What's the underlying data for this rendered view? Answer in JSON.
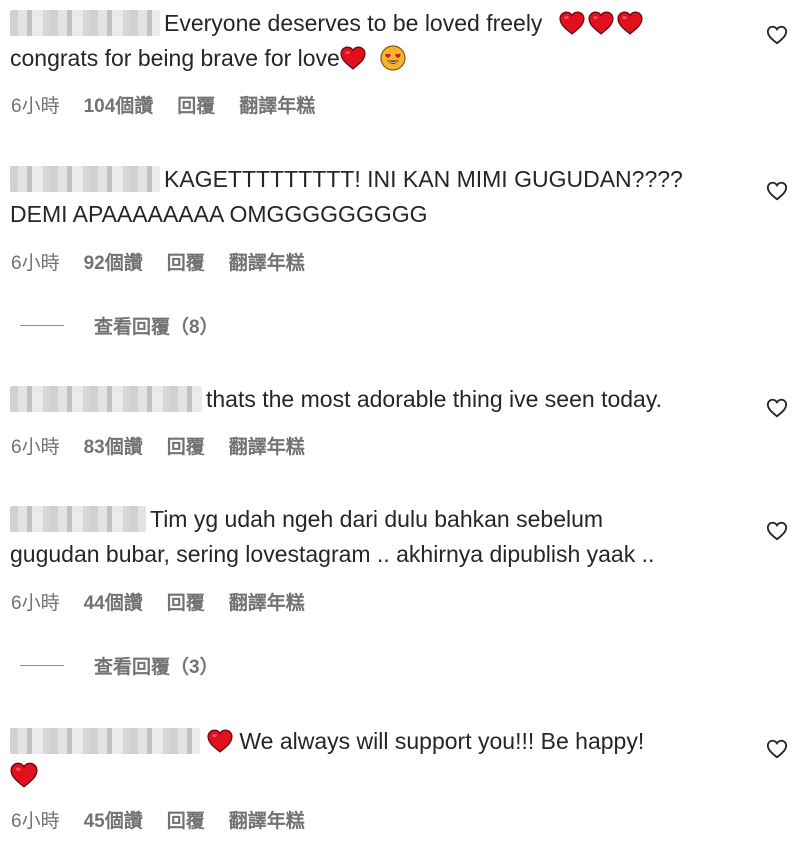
{
  "comments": [
    {
      "text_line1": "Everyone deserves to be loved freely",
      "text_line2": "congrats for being brave for love",
      "time": "6小時",
      "likes": "104個讚",
      "reply": "回覆",
      "translate": "翻譯年糕"
    },
    {
      "text_line1": "KAGETTTTTTTTT! INI KAN MIMI GUGUDAN????",
      "text_line2": "DEMI APAAAAAAAA OMGGGGGGGGG",
      "time": "6小時",
      "likes": "92個讚",
      "reply": "回覆",
      "translate": "翻譯年糕",
      "view_replies": "查看回覆（8）"
    },
    {
      "text_line1": "thats the most adorable thing ive seen today.",
      "time": "6小時",
      "likes": "83個讚",
      "reply": "回覆",
      "translate": "翻譯年糕"
    },
    {
      "text_line1": "Tim yg udah ngeh dari dulu bahkan sebelum",
      "text_line2": "gugudan bubar, sering lovestagram .. akhirnya dipublish yaak ..",
      "time": "6小時",
      "likes": "44個讚",
      "reply": "回覆",
      "translate": "翻譯年糕",
      "view_replies": "查看回覆（3）"
    },
    {
      "text_line1": "We always will support you!!! Be happy!",
      "time": "6小時",
      "likes": "45個讚",
      "reply": "回覆",
      "translate": "翻譯年糕"
    }
  ],
  "icons": {
    "like": "heart-outline-icon",
    "emoji_heart": "red-heart-emoji",
    "emoji_smile": "heart-eyes-emoji"
  },
  "colors": {
    "text": "#262626",
    "meta": "#737373",
    "heart": "#e0101e"
  }
}
